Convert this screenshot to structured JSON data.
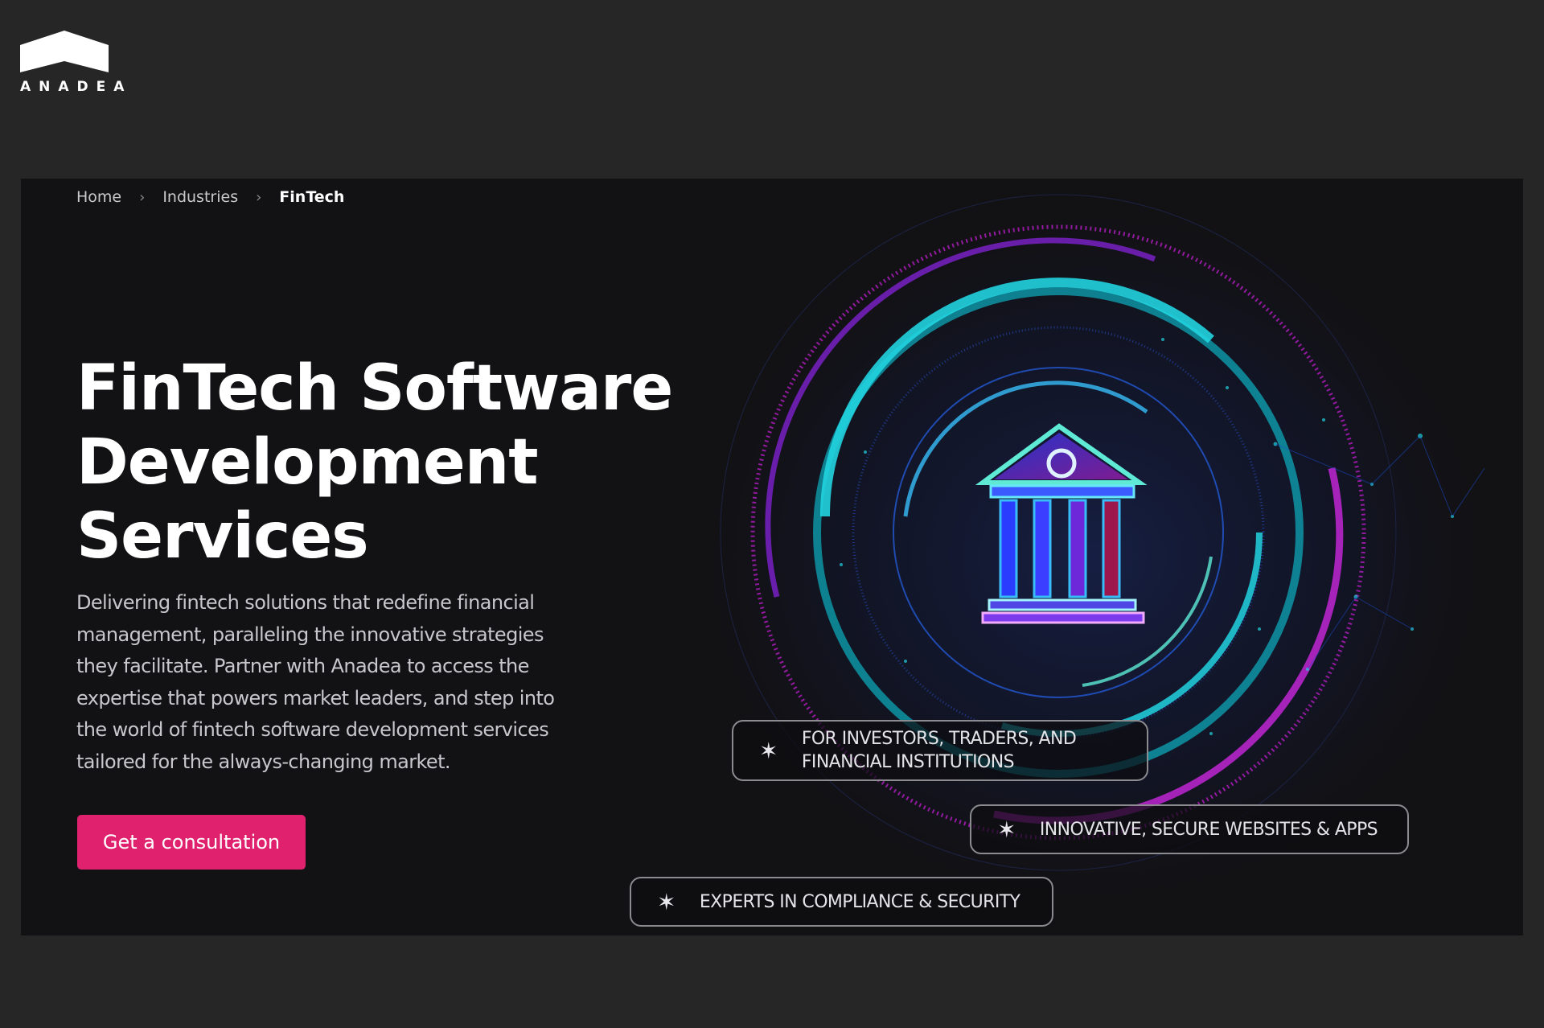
{
  "logo": {
    "text": "ANADEA"
  },
  "breadcrumb": {
    "home": "Home",
    "industries": "Industries",
    "current": "FinTech"
  },
  "hero": {
    "title_lines": [
      "FinTech Software",
      "Development",
      "Services"
    ],
    "description": "Delivering fintech solutions that redefine financial management, paralleling the innovative strategies they facilitate. Partner with Anadea to access the expertise that powers market leaders, and step into the world of fintech software development services tailored for the always-changing market.",
    "cta_label": "Get a consultation",
    "illustration_icon": "bank-building-icon"
  },
  "chips": [
    {
      "line1": "FOR INVESTORS, TRADERS, AND",
      "line2": "FINANCIAL INSTITUTIONS"
    },
    {
      "text": "INNOVATIVE, SECURE WEBSITES & APPS"
    },
    {
      "text": "EXPERTS IN COMPLIANCE & SECURITY"
    }
  ],
  "colors": {
    "page_bg": "#262627",
    "hero_bg": "#121214",
    "accent_pink": "#e0216e",
    "neon_cyan": "#22d3e0",
    "neon_magenta": "#c026d3",
    "neon_blue": "#3b5bff"
  }
}
